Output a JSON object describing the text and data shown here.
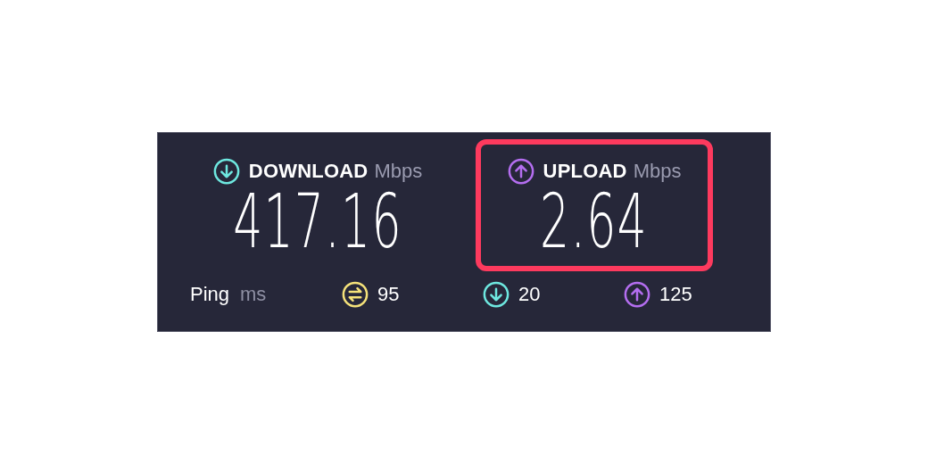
{
  "results": [
    {
      "kind": "download",
      "label": "DOWNLOAD",
      "unit": "Mbps",
      "value": "417.16"
    },
    {
      "kind": "upload",
      "label": "UPLOAD",
      "unit": "Mbps",
      "value": "2.64",
      "highlighted": true
    }
  ],
  "ping": {
    "label": "Ping",
    "unit": "ms",
    "values": [
      {
        "kind": "jitter",
        "value": "95"
      },
      {
        "kind": "download",
        "value": "20"
      },
      {
        "kind": "upload",
        "value": "125"
      }
    ]
  }
}
